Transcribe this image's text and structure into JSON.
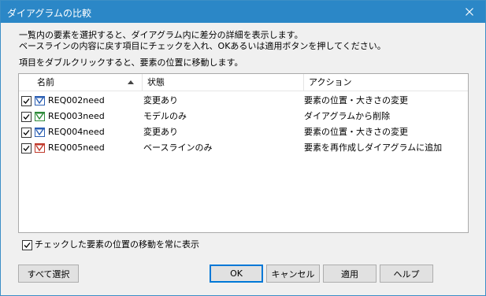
{
  "window": {
    "title": "ダイアグラムの比較",
    "close_icon": "close-icon"
  },
  "instructions": {
    "line1": "一覧内の要素を選択すると、ダイアグラム内に差分の詳細を表示します。",
    "line2": "ベースラインの内容に戻す項目にチェックを入れ、OKあるいは適用ボタンを押してください。",
    "line3": "項目をダブルクリックすると、要素の位置に移動します。"
  },
  "list": {
    "columns": [
      "名前",
      "状態",
      "アクション"
    ],
    "sorted_column": "名前",
    "rows": [
      {
        "checked": true,
        "icon": "element-icon-blue",
        "name": "REQ002need",
        "status": "変更あり",
        "action": "要素の位置・大きさの変更"
      },
      {
        "checked": true,
        "icon": "element-icon-green",
        "name": "REQ003need",
        "status": "モデルのみ",
        "action": "ダイアグラムから削除"
      },
      {
        "checked": true,
        "icon": "element-icon-blue",
        "name": "REQ004need",
        "status": "変更あり",
        "action": "要素の位置・大きさの変更"
      },
      {
        "checked": true,
        "icon": "element-icon-red",
        "name": "REQ005need",
        "status": "ベースラインのみ",
        "action": "要素を再作成しダイアグラムに追加"
      }
    ]
  },
  "options": {
    "always_show_label": "チェックした要素の位置の移動を常に表示",
    "always_show_checked": true
  },
  "buttons": {
    "select_all": "すべて選択",
    "ok": "OK",
    "cancel": "キャンセル",
    "apply": "適用",
    "help": "ヘルプ"
  },
  "colors": {
    "titlebar": "#2b87c7",
    "dialog_bg": "#f0f0f0",
    "accent": "#0078d7"
  }
}
